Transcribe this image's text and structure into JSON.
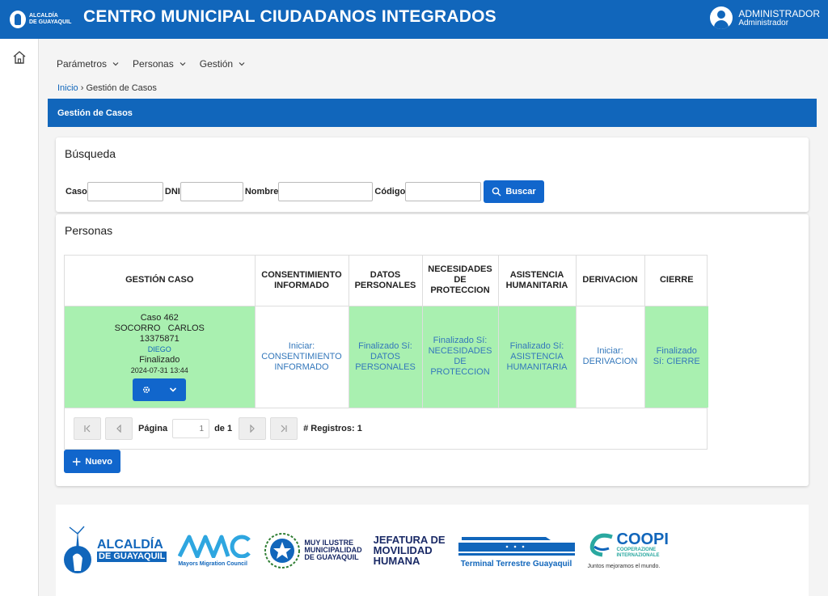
{
  "header": {
    "logo_line1": "ALCALDÍA",
    "logo_line2": "DE GUAYAQUIL",
    "title": "CENTRO MUNICIPAL CIUDADANOS INTEGRADOS",
    "user_name": "ADMINISTRADOR",
    "user_role": "Administrador"
  },
  "menu": [
    {
      "label": "Parámetros"
    },
    {
      "label": "Personas"
    },
    {
      "label": "Gestión"
    }
  ],
  "breadcrumb": {
    "home": "Inicio",
    "separator": "›",
    "current": "Gestión de Casos"
  },
  "section_title": "Gestión de Casos",
  "search": {
    "title": "Búsqueda",
    "fields": {
      "case_label": "Caso",
      "case_value": "",
      "dni_label": "DNI",
      "dni_value": "",
      "name_label": "Nombre",
      "name_value": "",
      "code_label": "Código",
      "code_value": ""
    },
    "button_label": "Buscar"
  },
  "persons": {
    "title": "Personas",
    "columns": [
      "GESTIÓN CASO",
      "CONSENTIMIENTO INFORMADO",
      "DATOS PERSONALES",
      "NECESIDADES DE PROTECCION",
      "ASISTENCIA HUMANITARIA",
      "DERIVACION",
      "CIERRE"
    ],
    "row": {
      "case": {
        "number": "Caso 462",
        "name": "SOCORRO   CARLOS",
        "dni": "13375871",
        "user": "DIEGO",
        "status": "Finalizado",
        "date": "2024-07-31 13:44"
      },
      "consent": "Iniciar: CONSENTIMIENTO INFORMADO",
      "personal": "Finalizado Sí: DATOS PERSONALES",
      "needs": "Finalizado Sí: NECESIDADES DE PROTECCION",
      "aid": "Finalizado Sí: ASISTENCIA HUMANITARIA",
      "referral": "Iniciar: DERIVACION",
      "closure": "Finalizado Sí: CIERRE"
    },
    "pager": {
      "page_label": "Página",
      "page_value": "1",
      "of_label": "de 1",
      "records_label": "# Registros: 1"
    }
  },
  "new_button": "Nuevo",
  "footer_logos": {
    "alcaldia_1": "ALCALDÍA",
    "alcaldia_2": "DE GUAYAQUIL",
    "mmc_text": "Mayors Migration Council",
    "muni_1": "MUY ILUSTRE",
    "muni_2": "MUNICIPALIDAD",
    "muni_3": "DE GUAYAQUIL",
    "jef_1": "JEFATURA DE",
    "jef_2": "MOVILIDAD",
    "jef_3": "HUMANA",
    "terminal": "Terminal Terrestre Guayaquil",
    "coopi_1": "COOPI",
    "coopi_2": "COOPERAZIONE INTERNAZIONALE",
    "coopi_3": "Juntos mejoramos el mundo."
  },
  "colors": {
    "primary": "#1166bb",
    "success_cell": "#a9f0b0"
  }
}
